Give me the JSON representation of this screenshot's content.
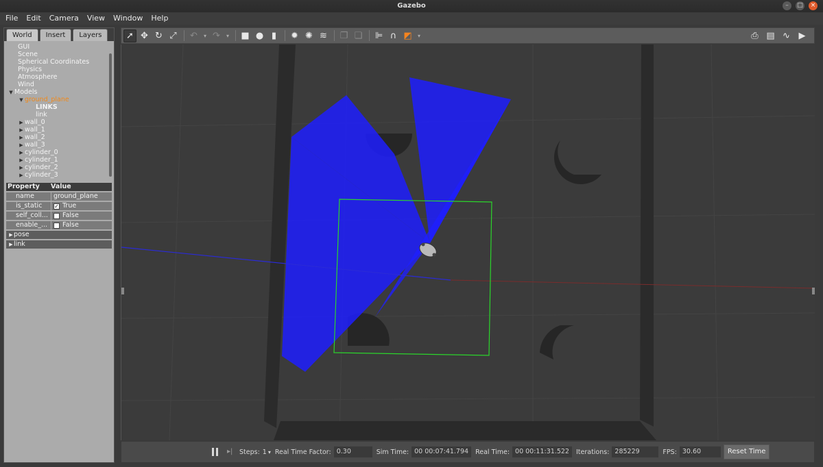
{
  "window": {
    "title": "Gazebo"
  },
  "menu": [
    "File",
    "Edit",
    "Camera",
    "View",
    "Window",
    "Help"
  ],
  "tabs": [
    "World",
    "Insert",
    "Layers"
  ],
  "tree": {
    "items": [
      "GUI",
      "Scene",
      "Spherical Coordinates",
      "Physics",
      "Atmosphere",
      "Wind"
    ],
    "models_label": "Models",
    "selected": "ground_plane",
    "links_header": "LINKS",
    "link": "link",
    "models": [
      "wall_0",
      "wall_1",
      "wall_2",
      "wall_3",
      "cylinder_0",
      "cylinder_1",
      "cylinder_2",
      "cylinder_3"
    ]
  },
  "properties": {
    "header_property": "Property",
    "header_value": "Value",
    "rows": [
      {
        "key": "name",
        "value": "ground_plane"
      },
      {
        "key": "is_static",
        "value": "True",
        "checked": true
      },
      {
        "key": "self_coll...",
        "value": "False",
        "checked": false
      },
      {
        "key": "enable_...",
        "value": "False",
        "checked": false
      }
    ],
    "sections": [
      "pose",
      "link"
    ]
  },
  "bottom": {
    "steps_label": "Steps:",
    "steps_value": "1",
    "rtf_label": "Real Time Factor:",
    "rtf_value": "0.30",
    "sim_time_label": "Sim Time:",
    "sim_time_value": "00 00:07:41.794",
    "real_time_label": "Real Time:",
    "real_time_value": "00 00:11:31.522",
    "iterations_label": "Iterations:",
    "iterations_value": "285229",
    "fps_label": "FPS:",
    "fps_value": "30.60",
    "reset_label": "Reset Time"
  },
  "colors": {
    "laser": "#1f1fff",
    "selection_box": "#2bd62b",
    "selected_text": "#f0891a",
    "viewport_bg": "#3b3b3b"
  }
}
